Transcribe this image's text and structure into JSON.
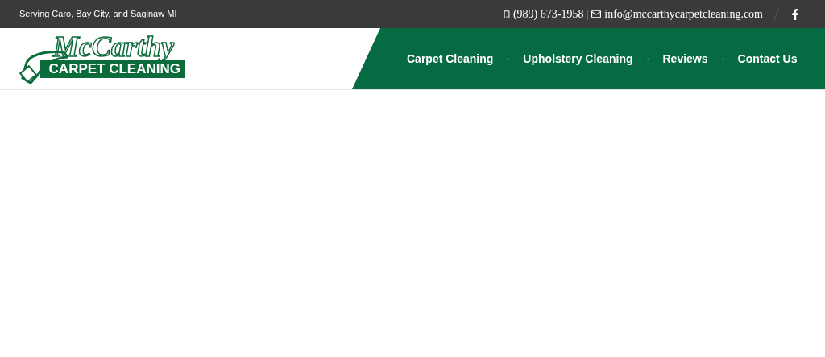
{
  "top_bar": {
    "service_area": "Serving Caro, Bay City, and Saginaw MI",
    "phone": "(989) 673-1958",
    "separator": "|",
    "email": "info@mccarthycarpetcleaning.com"
  },
  "logo": {
    "wordmark": "McCarthy",
    "tagline": "CARPET CLEANING"
  },
  "nav": {
    "items": [
      {
        "label": "Carpet Cleaning"
      },
      {
        "label": "Upholstery Cleaning"
      },
      {
        "label": "Reviews"
      },
      {
        "label": "Contact Us"
      }
    ]
  }
}
